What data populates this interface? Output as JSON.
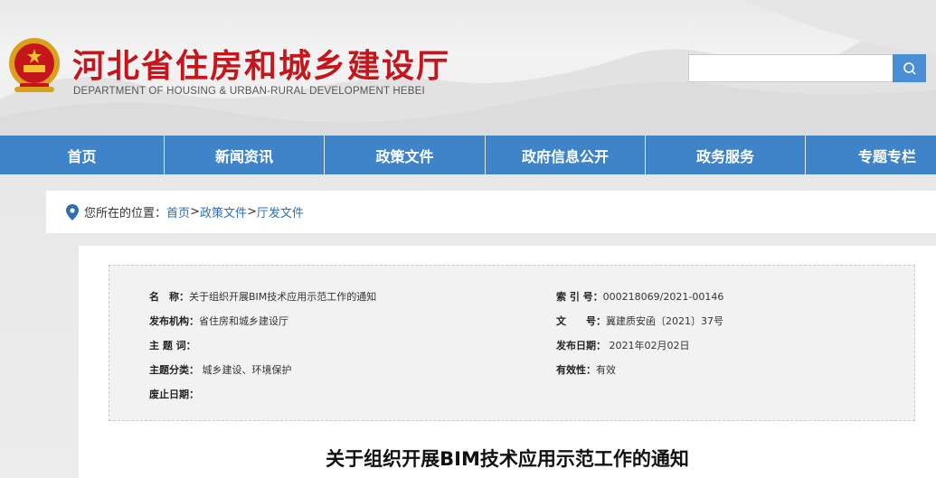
{
  "header": {
    "title_cn": "河北省住房和城乡建设厅",
    "title_en": "DEPARTMENT OF HOUSING & URBAN-RURAL DEVELOPMENT HEBEI",
    "search": {
      "placeholder": "",
      "icon": "search-icon"
    },
    "brand_color": "#c4161c"
  },
  "nav": {
    "color": "#3f84c8",
    "items": [
      {
        "label": "首页"
      },
      {
        "label": "新闻资讯"
      },
      {
        "label": "政策文件"
      },
      {
        "label": "政府信息公开"
      },
      {
        "label": "政务服务"
      },
      {
        "label": "专题专栏"
      }
    ]
  },
  "breadcrumb": {
    "icon": "location-pin-icon",
    "prefix": "您所在的位置：",
    "links": [
      "首页",
      "政策文件",
      "厅发文件"
    ],
    "separator": ">"
  },
  "meta": {
    "name_key": "名　称：",
    "name_val": "关于组织开展BIM技术应用示范工作的通知",
    "index_key": "索 引 号：",
    "index_val": "000218069/2021-00146",
    "org_key": "发布机构：",
    "org_val": "省住房和城乡建设厅",
    "docno_key": "文　　号：",
    "docno_val": "冀建质安函〔2021〕37号",
    "topic_key": "主 题 词：",
    "topic_val": "",
    "date_key": "发布日期：",
    "date_val": " 2021年02月02日",
    "category_key": "主题分类：",
    "category_val": " 城乡建设、环境保护",
    "valid_key": "有效性：",
    "valid_val": "有效",
    "expire_key": "废止日期：",
    "expire_val": ""
  },
  "document": {
    "title": "关于组织开展BIM技术应用示范工作的通知"
  }
}
